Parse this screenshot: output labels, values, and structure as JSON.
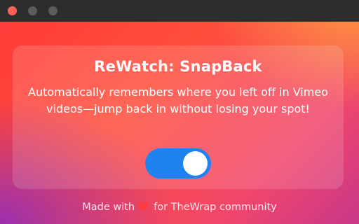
{
  "window": {
    "controls": [
      "close",
      "minimize",
      "zoom"
    ]
  },
  "card": {
    "title": "ReWatch: SnapBack",
    "description": "Automatically remembers where you left off in Vimeo videos—jump back in without losing your spot!",
    "toggle": {
      "state": "on",
      "accent_color": "#1e82f0"
    }
  },
  "footer": {
    "prefix": "Made with",
    "icon": "heart-icon",
    "icon_color": "#ff3b3b",
    "suffix": "for TheWrap community"
  }
}
